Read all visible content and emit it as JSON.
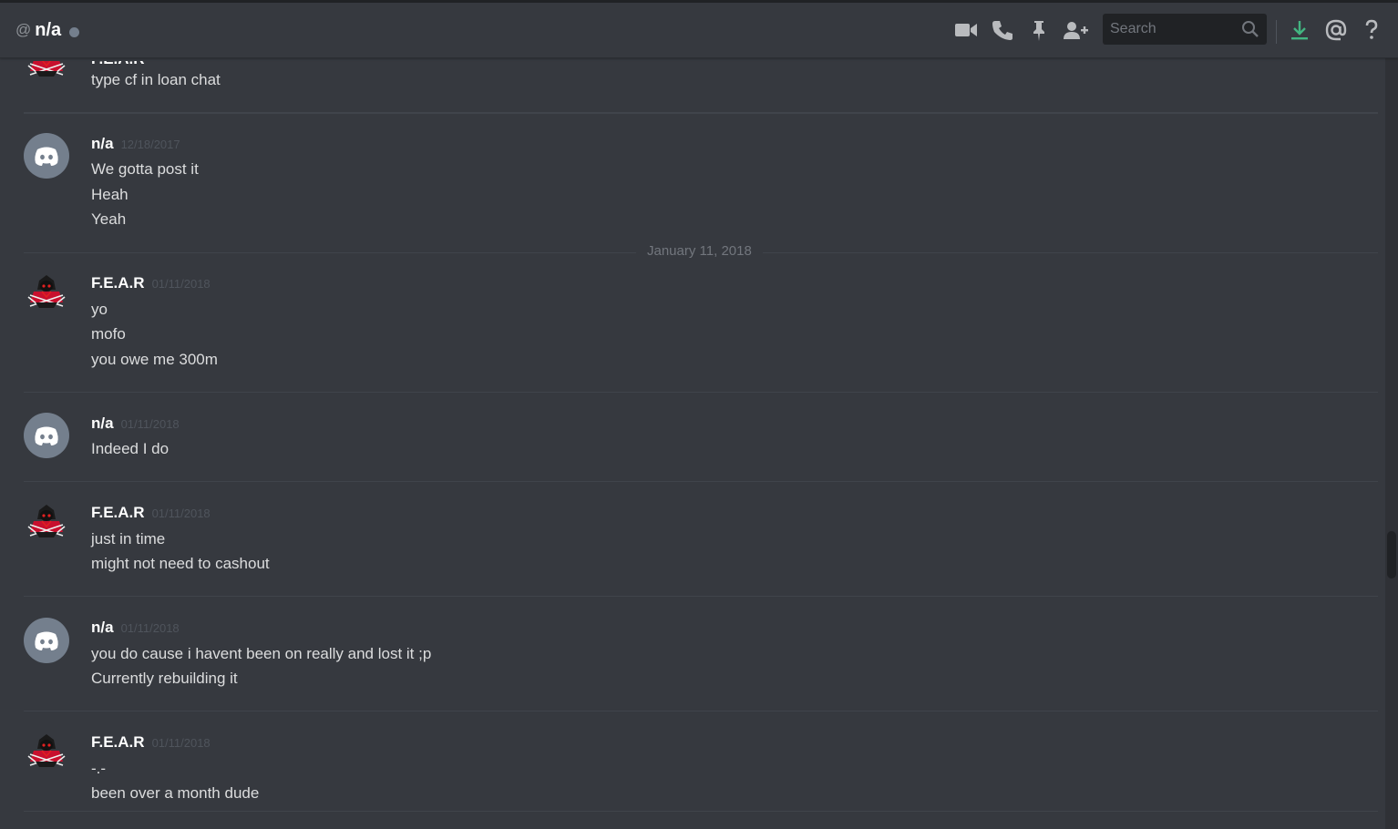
{
  "header": {
    "at_symbol": "@",
    "title": "n/a",
    "search_placeholder": "Search",
    "icons": [
      "video-icon",
      "phone-icon",
      "pin-icon",
      "add-friend-icon",
      "search-icon",
      "download-icon",
      "mention-icon",
      "help-icon"
    ],
    "accent_download": "#43b581"
  },
  "top_partial": {
    "author": "F.E.A.R",
    "text": "type cf in loan chat"
  },
  "messages": [
    {
      "author": "n/a",
      "timestamp": "12/18/2017",
      "avatar": "discord-default-icon",
      "lines": [
        "We gotta post it",
        "Heah",
        "Yeah"
      ]
    },
    {
      "author": "F.E.A.R",
      "timestamp": "01/11/2018",
      "avatar": "fear-avatar",
      "lines": [
        "yo",
        "mofo",
        "you owe me 300m"
      ]
    },
    {
      "author": "n/a",
      "timestamp": "01/11/2018",
      "avatar": "discord-default-icon",
      "lines": [
        "Indeed I do"
      ]
    },
    {
      "author": "F.E.A.R",
      "timestamp": "01/11/2018",
      "avatar": "fear-avatar",
      "lines": [
        "just in time",
        "might not need to cashout"
      ]
    },
    {
      "author": "n/a",
      "timestamp": "01/11/2018",
      "avatar": "discord-default-icon",
      "lines": [
        "you do cause i havent been on really and lost it ;p",
        "Currently rebuilding it"
      ]
    },
    {
      "author": "F.E.A.R",
      "timestamp": "01/11/2018",
      "avatar": "fear-avatar",
      "lines": [
        "-.-",
        "been over a month dude"
      ]
    }
  ],
  "date_divider": "January 11, 2018",
  "colors": {
    "background": "#36393f",
    "username": "#ffffff",
    "message_text": "#dcddde",
    "timestamp": "#4f545c",
    "discord_avatar_bg": "#747f8d",
    "fear_avatar_red": "#c8102e"
  }
}
